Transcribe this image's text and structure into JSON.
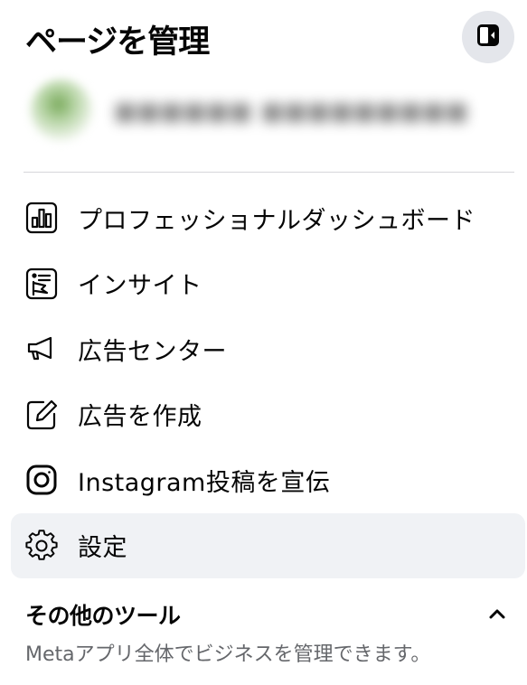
{
  "header": {
    "title": "ページを管理",
    "collapse_icon": "sidebar-collapse-icon"
  },
  "menu": {
    "items": [
      {
        "label": "プロフェッショナルダッシュボード",
        "icon": "dashboard-icon"
      },
      {
        "label": "インサイト",
        "icon": "insights-icon"
      },
      {
        "label": "広告センター",
        "icon": "megaphone-icon"
      },
      {
        "label": "広告を作成",
        "icon": "edit-icon"
      },
      {
        "label": "Instagram投稿を宣伝",
        "icon": "instagram-icon"
      },
      {
        "label": "設定",
        "icon": "gear-icon",
        "selected": true
      }
    ]
  },
  "tools_section": {
    "title": "その他のツール",
    "subtitle": "Metaアプリ全体でビジネスを管理できます。",
    "expanded": true
  },
  "colors": {
    "text_primary": "#050505",
    "text_secondary": "#65676b",
    "hover_bg": "#f0f2f5",
    "button_bg": "#e4e6eb",
    "divider": "#d6d7da"
  }
}
